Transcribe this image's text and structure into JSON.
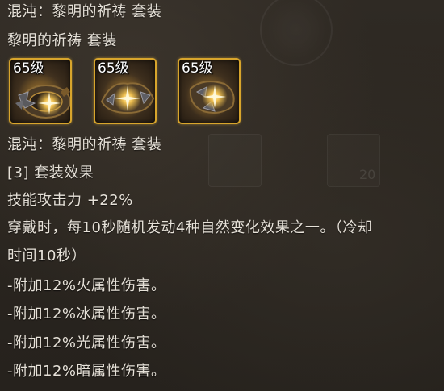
{
  "tooltip": {
    "set_title_line": "混沌：黎明的祈祷 套装",
    "set_name_line": "黎明的祈祷 套装",
    "set_items": [
      {
        "level": "65级",
        "icon": "gauntlet-icon"
      },
      {
        "level": "65级",
        "icon": "armor-piece-icon"
      },
      {
        "level": "65级",
        "icon": "gauntlet-icon"
      }
    ],
    "set_subtitle_line": "混沌：黎明的祈祷 套装",
    "set_effect_header": "[3] 套装效果",
    "lines": [
      "技能攻击力 +22%",
      "穿戴时，每10秒随机发动4种自然变化效果之一。（冷却",
      "时间10秒）",
      "-附加12%火属性伤害。",
      "-附加12%冰属性伤害。",
      "-附加12%光属性伤害。",
      "-附加12%暗属性伤害。"
    ],
    "ghost_number": "20"
  },
  "colors": {
    "background": "#2b2620",
    "text": "#e6e1d8",
    "slot_border": "#d8a52c"
  }
}
